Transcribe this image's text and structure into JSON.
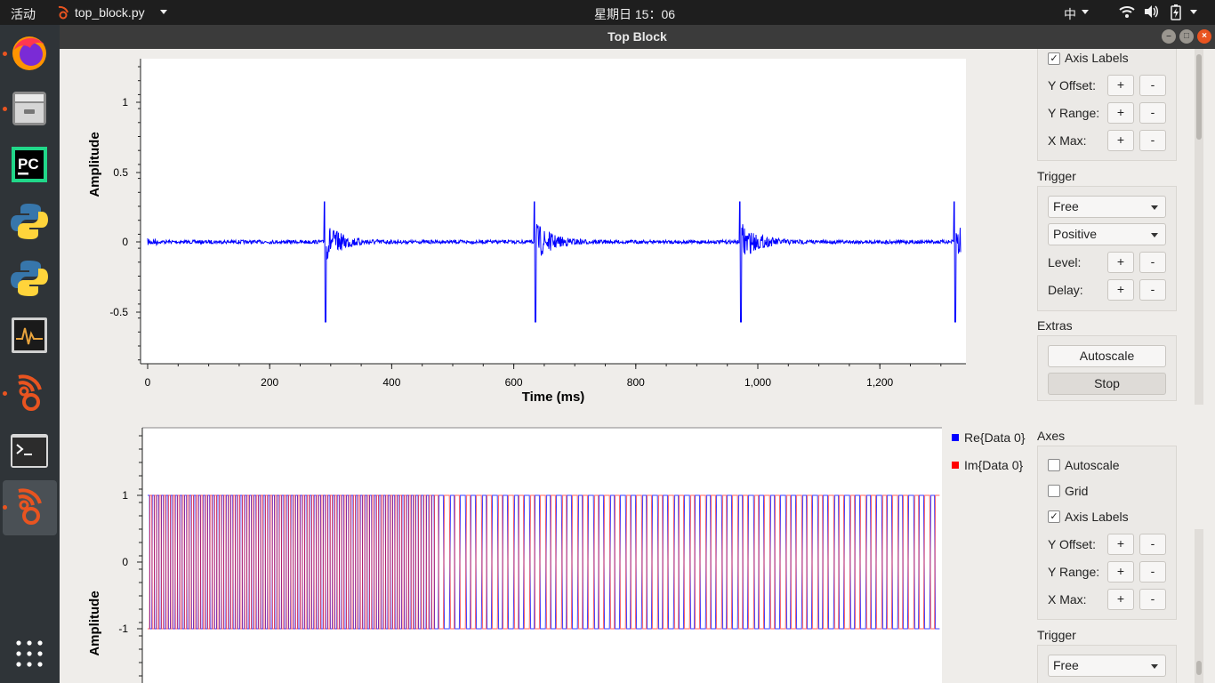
{
  "topbar": {
    "activities": "活动",
    "app_name": "top_block.py",
    "clock": "星期日 15：06",
    "input_method": "中"
  },
  "window": {
    "title": "Top Block"
  },
  "plot1": {
    "ylabel": "Amplitude",
    "xlabel": "Time (ms)",
    "yticks": [
      "1",
      "0.5",
      "0",
      "-0.5"
    ],
    "xticks": [
      "0",
      "200",
      "400",
      "600",
      "800",
      "1,000",
      "1,200"
    ],
    "line_color": "#0000ff"
  },
  "plot2": {
    "ylabel": "Amplitude",
    "yticks": [
      "1",
      "0",
      "-1"
    ],
    "legend": [
      {
        "label": "Re{Data 0}",
        "color": "#0000ff"
      },
      {
        "label": "Im{Data 0}",
        "color": "#ff0000"
      }
    ]
  },
  "controls1": {
    "axis_labels": "Axis Labels",
    "y_offset": "Y Offset:",
    "y_range": "Y Range:",
    "x_max": "X Max:",
    "plus": "+",
    "minus": "-",
    "trigger_title": "Trigger",
    "trigger_mode": "Free",
    "trigger_slope": "Positive",
    "level": "Level:",
    "delay": "Delay:",
    "extras_title": "Extras",
    "autoscale_btn": "Autoscale",
    "stop_btn": "Stop"
  },
  "controls2": {
    "axes_title": "Axes",
    "autoscale": "Autoscale",
    "grid": "Grid",
    "axis_labels": "Axis Labels",
    "y_offset": "Y Offset:",
    "y_range": "Y Range:",
    "x_max": "X Max:",
    "plus": "+",
    "minus": "-",
    "trigger_title": "Trigger",
    "trigger_mode": "Free"
  }
}
